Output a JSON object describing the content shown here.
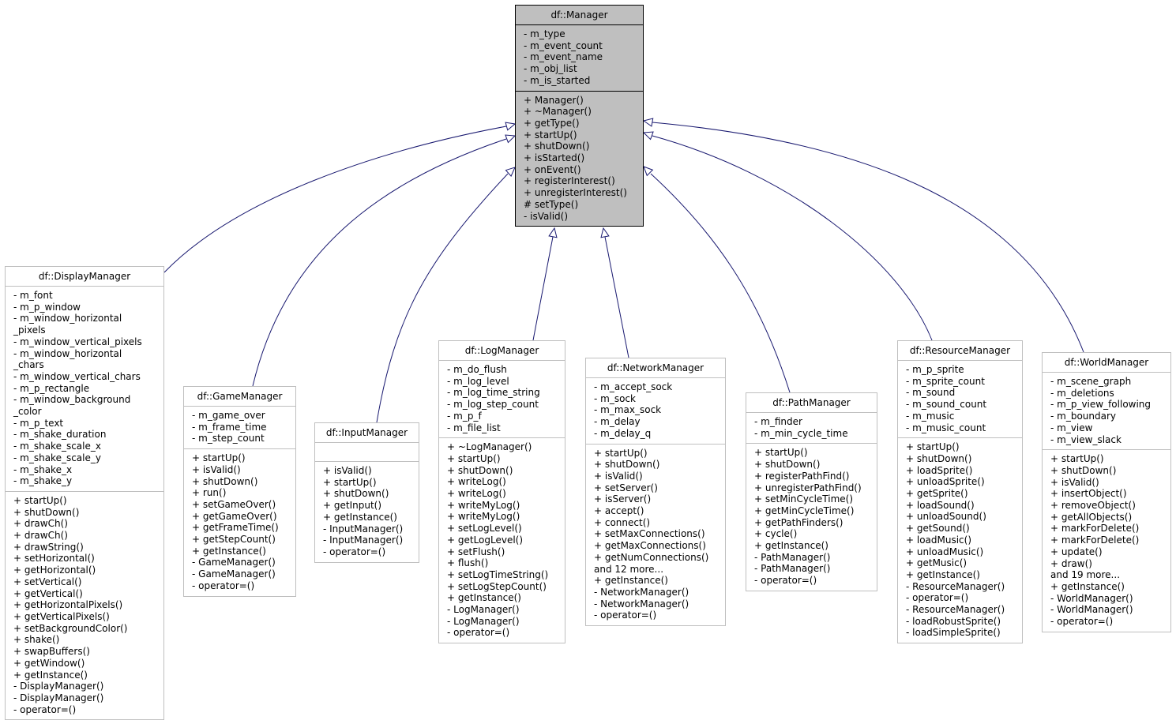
{
  "diagram": {
    "edge_color": "#191970",
    "base_fill": "#bfbfbf",
    "relationship": "inheritance",
    "classes": [
      {
        "id": "manager",
        "name": "df::Manager",
        "base": true,
        "attributes": [
          "- m_type",
          "- m_event_count",
          "- m_event_name",
          "- m_obj_list",
          "- m_is_started"
        ],
        "methods": [
          "+ Manager()",
          "+ ~Manager()",
          "+ getType()",
          "+ startUp()",
          "+ shutDown()",
          "+ isStarted()",
          "+ onEvent()",
          "+ registerInterest()",
          "+ unregisterInterest()",
          "# setType()",
          "- isValid()"
        ]
      },
      {
        "id": "display-manager",
        "name": "df::DisplayManager",
        "attributes": [
          "- m_font",
          "- m_p_window",
          "- m_window_horizontal",
          "_pixels",
          "- m_window_vertical_pixels",
          "- m_window_horizontal",
          "_chars",
          "- m_window_vertical_chars",
          "- m_p_rectangle",
          "- m_window_background",
          "_color",
          "- m_p_text",
          "- m_shake_duration",
          "- m_shake_scale_x",
          "- m_shake_scale_y",
          "- m_shake_x",
          "- m_shake_y"
        ],
        "methods": [
          "+ startUp()",
          "+ shutDown()",
          "+ drawCh()",
          "+ drawCh()",
          "+ drawString()",
          "+ setHorizontal()",
          "+ getHorizontal()",
          "+ setVertical()",
          "+ getVertical()",
          "+ getHorizontalPixels()",
          "+ getVerticalPixels()",
          "+ setBackgroundColor()",
          "+ shake()",
          "+ swapBuffers()",
          "+ getWindow()",
          "+ getInstance()",
          "- DisplayManager()",
          "- DisplayManager()",
          "- operator=()"
        ]
      },
      {
        "id": "game-manager",
        "name": "df::GameManager",
        "attributes": [
          "- m_game_over",
          "- m_frame_time",
          "- m_step_count"
        ],
        "methods": [
          "+ startUp()",
          "+ isValid()",
          "+ shutDown()",
          "+ run()",
          "+ setGameOver()",
          "+ getGameOver()",
          "+ getFrameTime()",
          "+ getStepCount()",
          "+ getInstance()",
          "- GameManager()",
          "- GameManager()",
          "- operator=()"
        ]
      },
      {
        "id": "input-manager",
        "name": "df::InputManager",
        "attributes": [],
        "methods": [
          "+ isValid()",
          "+ startUp()",
          "+ shutDown()",
          "+ getInput()",
          "+ getInstance()",
          "- InputManager()",
          "- InputManager()",
          "- operator=()"
        ]
      },
      {
        "id": "log-manager",
        "name": "df::LogManager",
        "attributes": [
          "- m_do_flush",
          "- m_log_level",
          "- m_log_time_string",
          "- m_log_step_count",
          "- m_p_f",
          "- m_file_list"
        ],
        "methods": [
          "+ ~LogManager()",
          "+ startUp()",
          "+ shutDown()",
          "+ writeLog()",
          "+ writeLog()",
          "+ writeMyLog()",
          "+ writeMyLog()",
          "+ setLogLevel()",
          "+ getLogLevel()",
          "+ setFlush()",
          "+ flush()",
          "+ setLogTimeString()",
          "+ setLogStepCount()",
          "+ getInstance()",
          "- LogManager()",
          "- LogManager()",
          "- operator=()"
        ]
      },
      {
        "id": "network-manager",
        "name": "df::NetworkManager",
        "attributes": [
          "- m_accept_sock",
          "- m_sock",
          "- m_max_sock",
          "- m_delay",
          "- m_delay_q"
        ],
        "methods": [
          "+ startUp()",
          "+ shutDown()",
          "+ isValid()",
          "+ setServer()",
          "+ isServer()",
          "+ accept()",
          "+ connect()",
          "+ setMaxConnections()",
          "+ getMaxConnections()",
          "+ getNumConnections()",
          "and 12 more...",
          "+ getInstance()",
          "- NetworkManager()",
          "- NetworkManager()",
          "- operator=()"
        ]
      },
      {
        "id": "path-manager",
        "name": "df::PathManager",
        "attributes": [
          "- m_finder",
          "- m_min_cycle_time"
        ],
        "methods": [
          "+ startUp()",
          "+ shutDown()",
          "+ registerPathFind()",
          "+ unregisterPathFind()",
          "+ setMinCycleTime()",
          "+ getMinCycleTime()",
          "+ getPathFinders()",
          "+ cycle()",
          "+ getInstance()",
          "- PathManager()",
          "- PathManager()",
          "- operator=()"
        ]
      },
      {
        "id": "resource-manager",
        "name": "df::ResourceManager",
        "attributes": [
          "- m_p_sprite",
          "- m_sprite_count",
          "- m_sound",
          "- m_sound_count",
          "- m_music",
          "- m_music_count"
        ],
        "methods": [
          "+ startUp()",
          "+ shutDown()",
          "+ loadSprite()",
          "+ unloadSprite()",
          "+ getSprite()",
          "+ loadSound()",
          "+ unloadSound()",
          "+ getSound()",
          "+ loadMusic()",
          "+ unloadMusic()",
          "+ getMusic()",
          "+ getInstance()",
          "- ResourceManager()",
          "- operator=()",
          "- ResourceManager()",
          "- loadRobustSprite()",
          "- loadSimpleSprite()"
        ]
      },
      {
        "id": "world-manager",
        "name": "df::WorldManager",
        "attributes": [
          "- m_scene_graph",
          "- m_deletions",
          "- m_p_view_following",
          "- m_boundary",
          "- m_view",
          "- m_view_slack"
        ],
        "methods": [
          "+ startUp()",
          "+ shutDown()",
          "+ isValid()",
          "+ insertObject()",
          "+ removeObject()",
          "+ getAllObjects()",
          "+ markForDelete()",
          "+ markForDelete()",
          "+ update()",
          "+ draw()",
          "and 19 more...",
          "+ getInstance()",
          "- WorldManager()",
          "- WorldManager()",
          "- operator=()"
        ]
      }
    ]
  }
}
